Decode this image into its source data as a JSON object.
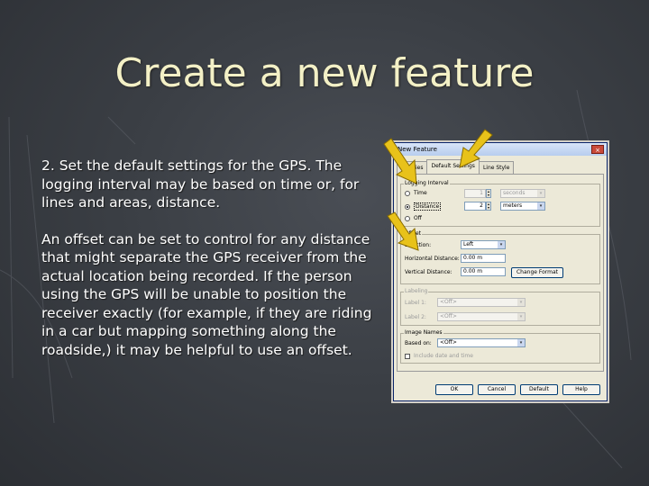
{
  "slide": {
    "title": "Create a new feature",
    "paragraph1": "2. Set the default settings for the GPS. The logging interval may be based on time or, for lines and areas, distance.",
    "paragraph2": "An offset can be set to control for any distance that might separate the GPS receiver from the actual location being recorded. If the person using the GPS will be unable to position the receiver exactly (for example, if they are riding in a car but mapping something along the roadside,) it may be helpful to use an offset."
  },
  "dialog": {
    "title": "New Feature",
    "close_glyph": "×",
    "tabs": [
      "operties",
      "Default Settings",
      "Line Style"
    ],
    "logging": {
      "label": "Logging Interval",
      "time_label": "Time",
      "time_value": "1",
      "time_unit": "seconds",
      "distance_label": "Distance",
      "distance_value": "2",
      "distance_unit": "meters",
      "off_label": "Off",
      "selected": "Distance"
    },
    "offset": {
      "label": "Offset",
      "direction_label": "Direction:",
      "direction_value": "Left",
      "horizontal_label": "Horizontal Distance:",
      "horizontal_value": "0.00 m",
      "vertical_label": "Vertical Distance:",
      "vertical_value": "0.00 m",
      "change_format": "Change Format"
    },
    "labeling": {
      "label": "Labeling",
      "label1": "Label 1:",
      "label1_value": "<Off>",
      "label2": "Label 2:",
      "label2_value": "<Off>"
    },
    "image_names": {
      "label": "Image Names",
      "based_on_label": "Based on:",
      "based_on_value": "<Off>",
      "include_label": "Include date and time"
    },
    "buttons": {
      "ok": "OK",
      "cancel": "Cancel",
      "default": "Default",
      "help": "Help"
    }
  },
  "colors": {
    "title": "#f3f0c6",
    "arrow": "#e8c21a",
    "arrow_outline": "#8a6d00"
  }
}
